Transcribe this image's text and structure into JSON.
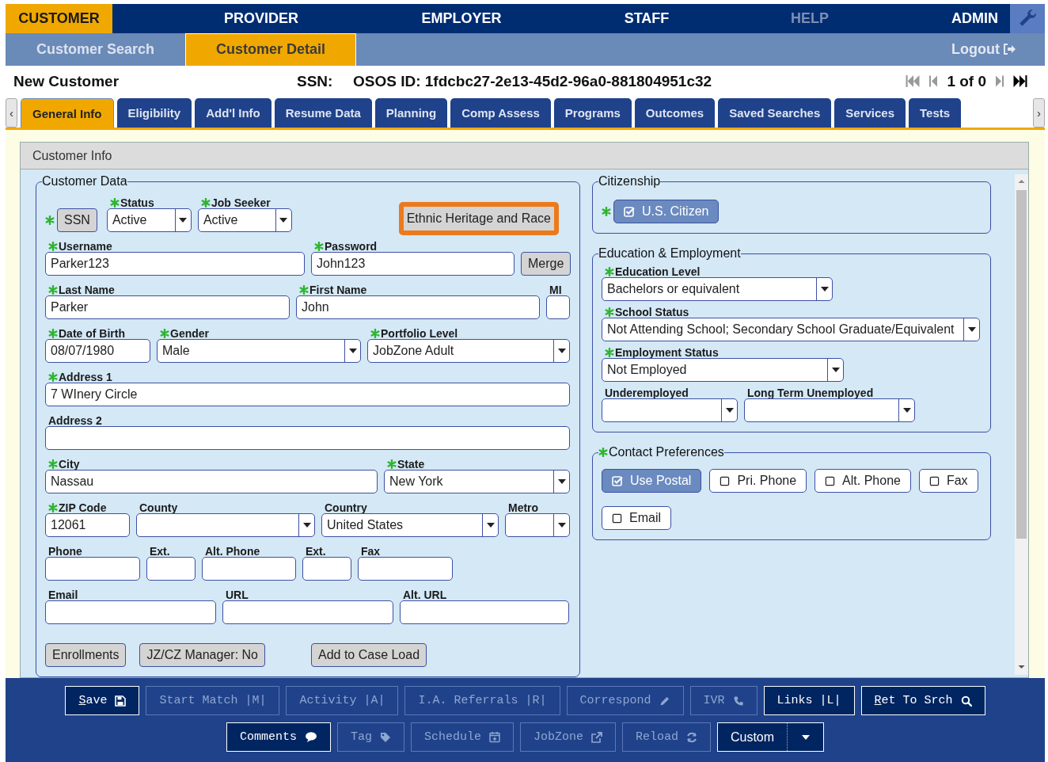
{
  "top_nav": [
    {
      "label": "CUSTOMER",
      "selected": true,
      "disabled": false
    },
    {
      "label": "PROVIDER",
      "selected": false,
      "disabled": false
    },
    {
      "label": "EMPLOYER",
      "selected": false,
      "disabled": false
    },
    {
      "label": "STAFF",
      "selected": false,
      "disabled": false
    },
    {
      "label": "HELP",
      "selected": false,
      "disabled": true
    },
    {
      "label": "ADMIN",
      "selected": false,
      "disabled": false
    }
  ],
  "sub_nav": {
    "tabs": [
      {
        "label": "Customer Search",
        "selected": false
      },
      {
        "label": "Customer Detail",
        "selected": true
      }
    ],
    "logout": "Logout"
  },
  "header": {
    "title": "New Customer",
    "ssn_label": "SSN:",
    "osos_id": "OSOS ID: 1fdcbc27-2e13-45d2-96a0-881804951c32",
    "pager": "1 of 0"
  },
  "tabs": {
    "scroll_left": "‹",
    "scroll_right": "›",
    "items": [
      {
        "label": "General Info",
        "selected": true
      },
      {
        "label": "Eligibility",
        "selected": false
      },
      {
        "label": "Add'l Info",
        "selected": false
      },
      {
        "label": "Resume Data",
        "selected": false
      },
      {
        "label": "Planning",
        "selected": false
      },
      {
        "label": "Comp Assess",
        "selected": false
      },
      {
        "label": "Programs",
        "selected": false
      },
      {
        "label": "Outcomes",
        "selected": false
      },
      {
        "label": "Saved Searches",
        "selected": false
      },
      {
        "label": "Services",
        "selected": false
      },
      {
        "label": "Tests",
        "selected": false
      }
    ]
  },
  "panel": {
    "title": "Customer Info"
  },
  "customer_data": {
    "legend": "Customer Data",
    "rows": [
      [
        {
          "kind": "button",
          "label": "SSN",
          "required": true
        },
        {
          "kind": "select",
          "label": "Status",
          "required": true,
          "value": "Active"
        },
        {
          "kind": "select",
          "label": "Job Seeker",
          "required": true,
          "value": "Active"
        },
        {
          "kind": "highlight_button",
          "label": "Ethnic Heritage and Race"
        }
      ],
      [
        {
          "kind": "text",
          "label": "Username",
          "required": true,
          "value": "Parker123"
        },
        {
          "kind": "text",
          "label": "Password",
          "required": true,
          "value": "John123"
        },
        {
          "kind": "button",
          "label": "Merge"
        }
      ],
      [
        {
          "kind": "text",
          "label": "Last Name",
          "required": true,
          "value": "Parker"
        },
        {
          "kind": "text",
          "label": "First Name",
          "required": true,
          "value": "John"
        },
        {
          "kind": "text",
          "label": "MI",
          "required": false
        }
      ],
      [
        {
          "kind": "text",
          "label": "Date of Birth",
          "required": true,
          "value": "08/07/1980"
        },
        {
          "kind": "select",
          "label": "Gender",
          "required": true,
          "value": "Male"
        },
        {
          "kind": "select",
          "label": "Portfolio Level",
          "required": true,
          "value": "JobZone Adult"
        }
      ],
      [
        {
          "kind": "text",
          "label": "Address 1",
          "required": true,
          "value": "7 WInery Circle"
        }
      ],
      [
        {
          "kind": "text",
          "label": "Address 2",
          "required": false
        }
      ],
      [
        {
          "kind": "text",
          "label": "City",
          "required": true,
          "value": "Nassau"
        },
        {
          "kind": "select",
          "label": "State",
          "required": true,
          "value": "New York"
        }
      ],
      [
        {
          "kind": "text",
          "label": "ZIP Code",
          "required": true,
          "value": "12061"
        },
        {
          "kind": "select",
          "label": "County",
          "required": false
        },
        {
          "kind": "select",
          "label": "Country",
          "required": false,
          "value": "United States"
        },
        {
          "kind": "select",
          "label": "Metro",
          "required": false
        }
      ],
      [
        {
          "kind": "text",
          "label": "Phone",
          "required": false
        },
        {
          "kind": "text",
          "label": "Ext.",
          "required": false
        },
        {
          "kind": "text",
          "label": "Alt. Phone",
          "required": false
        },
        {
          "kind": "text",
          "label": "Ext.",
          "required": false
        },
        {
          "kind": "text",
          "label": "Fax",
          "required": false
        }
      ],
      [
        {
          "kind": "text",
          "label": "Email",
          "required": false
        },
        {
          "kind": "text",
          "label": "URL",
          "required": false
        },
        {
          "kind": "text",
          "label": "Alt. URL",
          "required": false
        }
      ],
      [
        {
          "kind": "button",
          "label": "Enrollments"
        },
        {
          "kind": "button",
          "label": "JZ/CZ Manager: No"
        },
        {
          "kind": "button",
          "label": "Add to Case Load"
        }
      ]
    ]
  },
  "citizenship": {
    "legend": "Citizenship",
    "toggle": {
      "label": "U.S. Citizen",
      "checked": true,
      "required": true
    }
  },
  "education_employment": {
    "legend": "Education & Employment",
    "rows": [
      [
        {
          "kind": "select",
          "label": "Education Level",
          "required": true,
          "value": "Bachelors or equivalent"
        }
      ],
      [
        {
          "kind": "select",
          "label": "School Status",
          "required": true,
          "value": "Not Attending School; Secondary School Graduate/Equivalent"
        }
      ],
      [
        {
          "kind": "select",
          "label": "Employment Status",
          "required": true,
          "value": "Not Employed"
        }
      ],
      [
        {
          "kind": "select",
          "label": "Underemployed",
          "required": false
        },
        {
          "kind": "select",
          "label": "Long Term Unemployed",
          "required": false
        }
      ]
    ]
  },
  "contact_preferences": {
    "legend": "Contact Preferences",
    "required": true,
    "options": [
      {
        "label": "Use Postal",
        "checked": true
      },
      {
        "label": "Pri. Phone",
        "checked": false
      },
      {
        "label": "Alt. Phone",
        "checked": false
      },
      {
        "label": "Fax",
        "checked": false
      },
      {
        "label": "Email",
        "checked": false
      }
    ]
  },
  "toolbar": {
    "buttons": [
      {
        "kind": "button",
        "label": "Save",
        "disabled": false,
        "underline_first": true
      },
      {
        "kind": "button",
        "label": "Start Match |M|",
        "disabled": true,
        "underline_first": false
      },
      {
        "kind": "button",
        "label": "Activity |A|",
        "disabled": true,
        "underline_first": false
      },
      {
        "kind": "button",
        "label": "I.A. Referrals |R|",
        "disabled": true,
        "underline_first": false
      },
      {
        "kind": "button",
        "label": "Correspond",
        "disabled": true,
        "underline_first": false
      },
      {
        "kind": "button",
        "label": "IVR",
        "disabled": true,
        "underline_first": false
      },
      {
        "kind": "button",
        "label": "Links |L|",
        "disabled": false,
        "underline_first": false
      },
      {
        "kind": "button",
        "label": "Ret To Srch",
        "disabled": false,
        "underline_first": true
      },
      {
        "kind": "button",
        "label": "Comments",
        "disabled": false,
        "underline_first": false
      },
      {
        "kind": "button",
        "label": "Tag",
        "disabled": true,
        "underline_first": false
      },
      {
        "kind": "button",
        "label": "Schedule",
        "disabled": true,
        "underline_first": false
      },
      {
        "kind": "button",
        "label": "JobZone",
        "disabled": true,
        "underline_first": false
      },
      {
        "kind": "button",
        "label": "Reload",
        "disabled": true,
        "underline_first": false
      },
      {
        "kind": "split",
        "label": "Custom",
        "disabled": false,
        "underline_first": false
      }
    ]
  }
}
